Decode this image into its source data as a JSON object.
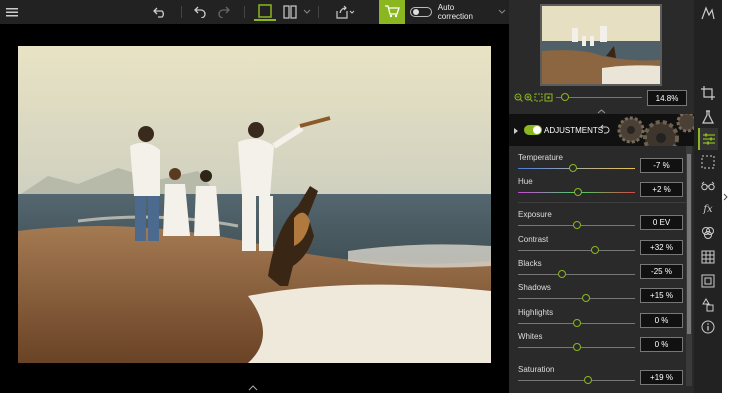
{
  "toolbar": {
    "menu_icon": "hamburger-icon",
    "undo_history_icon": "undo-history-icon",
    "undo_icon": "undo-icon",
    "redo_icon": "redo-icon",
    "single_view_icon": "single-view-icon",
    "compare_view_icon": "compare-view-icon",
    "export_icon": "export-icon",
    "cart_icon": "cart-icon",
    "auto_correction_label": "Auto correction",
    "auto_correction_on": false
  },
  "panel": {
    "zoom_value": "14.8%",
    "adjustments_title": "ADJUSTMENTS",
    "adjustments_enabled": true,
    "sliders": [
      {
        "label": "Temperature",
        "value": "-7 %",
        "level": 0.47
      },
      {
        "label": "Hue",
        "value": "+2 %",
        "level": 0.51
      },
      {
        "label": "Exposure",
        "value": "0 EV",
        "level": 0.5
      },
      {
        "label": "Contrast",
        "value": "+32 %",
        "level": 0.66
      },
      {
        "label": "Blacks",
        "value": "-25 %",
        "level": 0.38
      },
      {
        "label": "Shadows",
        "value": "+15 %",
        "level": 0.58
      },
      {
        "label": "Highlights",
        "value": "0 %",
        "level": 0.5
      },
      {
        "label": "Whites",
        "value": "0 %",
        "level": 0.5
      },
      {
        "label": "Saturation",
        "value": "+19 %",
        "level": 0.6
      }
    ]
  },
  "strip": {
    "icons": [
      "histogram-icon",
      "crop-icon",
      "flask-icon",
      "sliders-icon",
      "selection-icon",
      "glasses-icon",
      "fx-icon",
      "color-circles-icon",
      "grid-icon",
      "frame-icon",
      "shapes-icon",
      "info-icon"
    ]
  },
  "colors": {
    "accent": "#8ab61f",
    "panel": "#2a2a2a",
    "toolbar": "#222222"
  }
}
